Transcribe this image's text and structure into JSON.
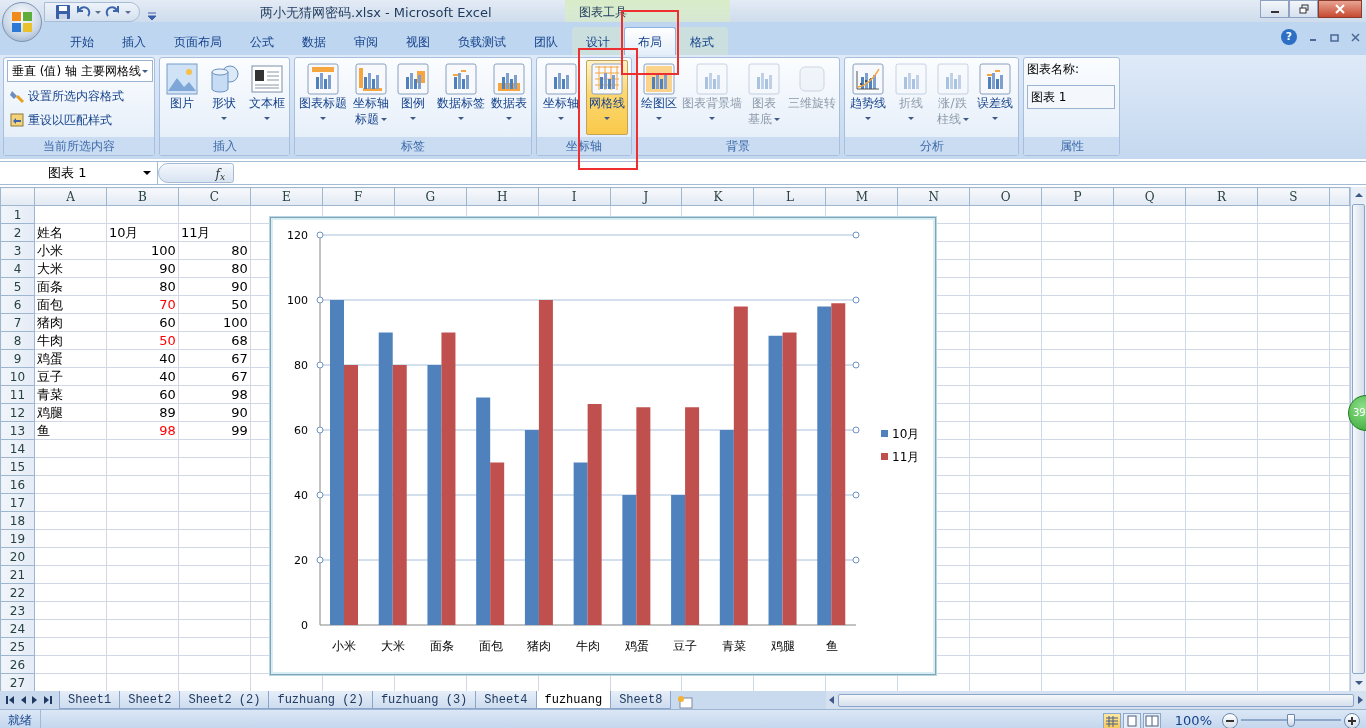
{
  "window": {
    "title": "两小无猜网密码.xlsx  -  Microsoft Excel",
    "tool_group": "图表工具",
    "help_button": "?"
  },
  "ribbon_tabs": [
    {
      "label": "开始",
      "selected": false,
      "contextual": false
    },
    {
      "label": "插入",
      "selected": false,
      "contextual": false
    },
    {
      "label": "页面布局",
      "selected": false,
      "contextual": false
    },
    {
      "label": "公式",
      "selected": false,
      "contextual": false
    },
    {
      "label": "数据",
      "selected": false,
      "contextual": false
    },
    {
      "label": "审阅",
      "selected": false,
      "contextual": false
    },
    {
      "label": "视图",
      "selected": false,
      "contextual": false
    },
    {
      "label": "负载测试",
      "selected": false,
      "contextual": false
    },
    {
      "label": "团队",
      "selected": false,
      "contextual": false
    },
    {
      "label": "设计",
      "selected": false,
      "contextual": true
    },
    {
      "label": "布局",
      "selected": true,
      "contextual": true
    },
    {
      "label": "格式",
      "selected": false,
      "contextual": true
    }
  ],
  "ribbon_groups": [
    {
      "label": "当前所选内容",
      "items": [
        {
          "kind": "dropdown",
          "label": "垂直 (值) 轴 主要网格线"
        },
        {
          "kind": "small",
          "label": "设置所选内容格式"
        },
        {
          "kind": "small",
          "label": "重设以匹配样式"
        }
      ]
    },
    {
      "label": "插入",
      "items": [
        {
          "kind": "large",
          "lines": [
            "图片"
          ],
          "menu": false,
          "disabled": false,
          "selected": false
        },
        {
          "kind": "large",
          "lines": [
            "形状"
          ],
          "menu": true,
          "disabled": false,
          "selected": false
        },
        {
          "kind": "large",
          "lines": [
            "文本框"
          ],
          "menu": true,
          "disabled": false,
          "selected": false
        }
      ]
    },
    {
      "label": "标签",
      "items": [
        {
          "kind": "large",
          "lines": [
            "图表标题"
          ],
          "menu": true,
          "disabled": false,
          "selected": false
        },
        {
          "kind": "large",
          "lines": [
            "坐标轴",
            "标题"
          ],
          "menu": true,
          "disabled": false,
          "selected": false
        },
        {
          "kind": "large",
          "lines": [
            "图例"
          ],
          "menu": true,
          "disabled": false,
          "selected": false
        },
        {
          "kind": "large",
          "lines": [
            "数据标签"
          ],
          "menu": true,
          "disabled": false,
          "selected": false
        },
        {
          "kind": "large",
          "lines": [
            "数据表"
          ],
          "menu": true,
          "disabled": false,
          "selected": false
        }
      ]
    },
    {
      "label": "坐标轴",
      "items": [
        {
          "kind": "large",
          "lines": [
            "坐标轴"
          ],
          "menu": true,
          "disabled": false,
          "selected": false
        },
        {
          "kind": "large",
          "lines": [
            "网格线"
          ],
          "menu": true,
          "disabled": false,
          "selected": true
        }
      ]
    },
    {
      "label": "背景",
      "items": [
        {
          "kind": "large",
          "lines": [
            "绘图区"
          ],
          "menu": true,
          "disabled": false,
          "selected": false
        },
        {
          "kind": "large",
          "lines": [
            "图表背景墙"
          ],
          "menu": true,
          "disabled": true,
          "selected": false
        },
        {
          "kind": "large",
          "lines": [
            "图表",
            "基底"
          ],
          "menu": true,
          "disabled": true,
          "selected": false
        },
        {
          "kind": "large",
          "lines": [
            "三维旋转"
          ],
          "menu": false,
          "disabled": true,
          "selected": false
        }
      ]
    },
    {
      "label": "分析",
      "items": [
        {
          "kind": "large",
          "lines": [
            "趋势线"
          ],
          "menu": true,
          "disabled": false,
          "selected": false
        },
        {
          "kind": "large",
          "lines": [
            "折线"
          ],
          "menu": true,
          "disabled": true,
          "selected": false
        },
        {
          "kind": "large",
          "lines": [
            "涨/跌",
            "柱线"
          ],
          "menu": true,
          "disabled": true,
          "selected": false
        },
        {
          "kind": "large",
          "lines": [
            "误差线"
          ],
          "menu": true,
          "disabled": false,
          "selected": false
        }
      ]
    },
    {
      "label": "属性",
      "items": [
        {
          "kind": "name_field",
          "label": "图表名称:",
          "value": "图表 1"
        }
      ]
    }
  ],
  "formula_bar": {
    "name_box": "图表 1",
    "function_label": "f$_{x}$"
  },
  "columns": [
    "A",
    "B",
    "C",
    "E",
    "F",
    "G",
    "H",
    "I",
    "J",
    "K",
    "L",
    "M",
    "N",
    "O",
    "P",
    "Q",
    "R",
    "S"
  ],
  "rows": [
    {
      "number": "1",
      "cells": []
    },
    {
      "number": "2",
      "cells": [
        {
          "text": "姓名",
          "kind": "text",
          "highlighted": false
        },
        {
          "text": "10月",
          "kind": "text",
          "highlighted": false
        },
        {
          "text": "11月",
          "kind": "text",
          "highlighted": false
        }
      ]
    },
    {
      "number": "3",
      "cells": [
        {
          "text": "小米",
          "kind": "text",
          "highlighted": false
        },
        {
          "text": "100",
          "kind": "number",
          "highlighted": false
        },
        {
          "text": "80",
          "kind": "number",
          "highlighted": false
        }
      ]
    },
    {
      "number": "4",
      "cells": [
        {
          "text": "大米",
          "kind": "text",
          "highlighted": false
        },
        {
          "text": "90",
          "kind": "number",
          "highlighted": false
        },
        {
          "text": "80",
          "kind": "number",
          "highlighted": false
        }
      ]
    },
    {
      "number": "5",
      "cells": [
        {
          "text": "面条",
          "kind": "text",
          "highlighted": false
        },
        {
          "text": "80",
          "kind": "number",
          "highlighted": false
        },
        {
          "text": "90",
          "kind": "number",
          "highlighted": false
        }
      ]
    },
    {
      "number": "6",
      "cells": [
        {
          "text": "面包",
          "kind": "text",
          "highlighted": false
        },
        {
          "text": "70",
          "kind": "number",
          "highlighted": true
        },
        {
          "text": "50",
          "kind": "number",
          "highlighted": false
        }
      ]
    },
    {
      "number": "7",
      "cells": [
        {
          "text": "猪肉",
          "kind": "text",
          "highlighted": false
        },
        {
          "text": "60",
          "kind": "number",
          "highlighted": false
        },
        {
          "text": "100",
          "kind": "number",
          "highlighted": false
        }
      ]
    },
    {
      "number": "8",
      "cells": [
        {
          "text": "牛肉",
          "kind": "text",
          "highlighted": false
        },
        {
          "text": "50",
          "kind": "number",
          "highlighted": true
        },
        {
          "text": "68",
          "kind": "number",
          "highlighted": false
        }
      ]
    },
    {
      "number": "9",
      "cells": [
        {
          "text": "鸡蛋",
          "kind": "text",
          "highlighted": false
        },
        {
          "text": "40",
          "kind": "number",
          "highlighted": false
        },
        {
          "text": "67",
          "kind": "number",
          "highlighted": false
        }
      ]
    },
    {
      "number": "10",
      "cells": [
        {
          "text": "豆子",
          "kind": "text",
          "highlighted": false
        },
        {
          "text": "40",
          "kind": "number",
          "highlighted": false
        },
        {
          "text": "67",
          "kind": "number",
          "highlighted": false
        }
      ]
    },
    {
      "number": "11",
      "cells": [
        {
          "text": "青菜",
          "kind": "text",
          "highlighted": false
        },
        {
          "text": "60",
          "kind": "number",
          "highlighted": false
        },
        {
          "text": "98",
          "kind": "number",
          "highlighted": false
        }
      ]
    },
    {
      "number": "12",
      "cells": [
        {
          "text": "鸡腿",
          "kind": "text",
          "highlighted": false
        },
        {
          "text": "89",
          "kind": "number",
          "highlighted": false
        },
        {
          "text": "90",
          "kind": "number",
          "highlighted": false
        }
      ]
    },
    {
      "number": "13",
      "cells": [
        {
          "text": "鱼",
          "kind": "text",
          "highlighted": false
        },
        {
          "text": "98",
          "kind": "number",
          "highlighted": true
        },
        {
          "text": "99",
          "kind": "number",
          "highlighted": false
        }
      ]
    },
    {
      "number": "14",
      "cells": []
    },
    {
      "number": "15",
      "cells": []
    },
    {
      "number": "16",
      "cells": []
    },
    {
      "number": "17",
      "cells": []
    },
    {
      "number": "18",
      "cells": []
    },
    {
      "number": "19",
      "cells": []
    },
    {
      "number": "20",
      "cells": []
    },
    {
      "number": "21",
      "cells": []
    },
    {
      "number": "22",
      "cells": []
    },
    {
      "number": "23",
      "cells": []
    },
    {
      "number": "24",
      "cells": []
    },
    {
      "number": "25",
      "cells": []
    },
    {
      "number": "26",
      "cells": []
    },
    {
      "number": "27",
      "cells": []
    }
  ],
  "chart": {
    "gridlines_selected": true,
    "chart_data": {
      "type": "bar",
      "categories": [
        "小米",
        "大米",
        "面条",
        "面包",
        "猪肉",
        "牛肉",
        "鸡蛋",
        "豆子",
        "青菜",
        "鸡腿",
        "鱼"
      ],
      "series": [
        {
          "name": "10月",
          "color": "#4f81bd",
          "values": [
            100,
            90,
            80,
            70,
            60,
            50,
            40,
            40,
            60,
            89,
            98
          ]
        },
        {
          "name": "11月",
          "color": "#c0504d",
          "values": [
            80,
            80,
            90,
            50,
            100,
            68,
            67,
            67,
            98,
            90,
            99
          ]
        }
      ],
      "ylim": [
        0,
        120
      ],
      "yticks": [
        {
          "value": 0,
          "label": "0"
        },
        {
          "value": 20,
          "label": "20"
        },
        {
          "value": 40,
          "label": "40"
        },
        {
          "value": 60,
          "label": "60"
        },
        {
          "value": 80,
          "label": "80"
        },
        {
          "value": 100,
          "label": "100"
        },
        {
          "value": 120,
          "label": "120"
        }
      ],
      "grid": true,
      "legend": true
    }
  },
  "side_badge": "39",
  "sheet_tabs": [
    {
      "label": "Sheet1",
      "selected": false
    },
    {
      "label": "Sheet2",
      "selected": false
    },
    {
      "label": "Sheet2 (2)",
      "selected": false
    },
    {
      "label": "fuzhuang (2)",
      "selected": false
    },
    {
      "label": "fuzhuang (3)",
      "selected": false
    },
    {
      "label": "Sheet4",
      "selected": false
    },
    {
      "label": "fuzhuang",
      "selected": true
    },
    {
      "label": "Sheet8",
      "selected": false
    }
  ],
  "status_bar": {
    "text": "就绪",
    "views": [
      {
        "kind": "normal",
        "selected": true
      },
      {
        "kind": "page_layout",
        "selected": false
      },
      {
        "kind": "page_break",
        "selected": false
      }
    ],
    "zoom": "100%",
    "zoom_slider": {
      "level": 0.5
    }
  }
}
